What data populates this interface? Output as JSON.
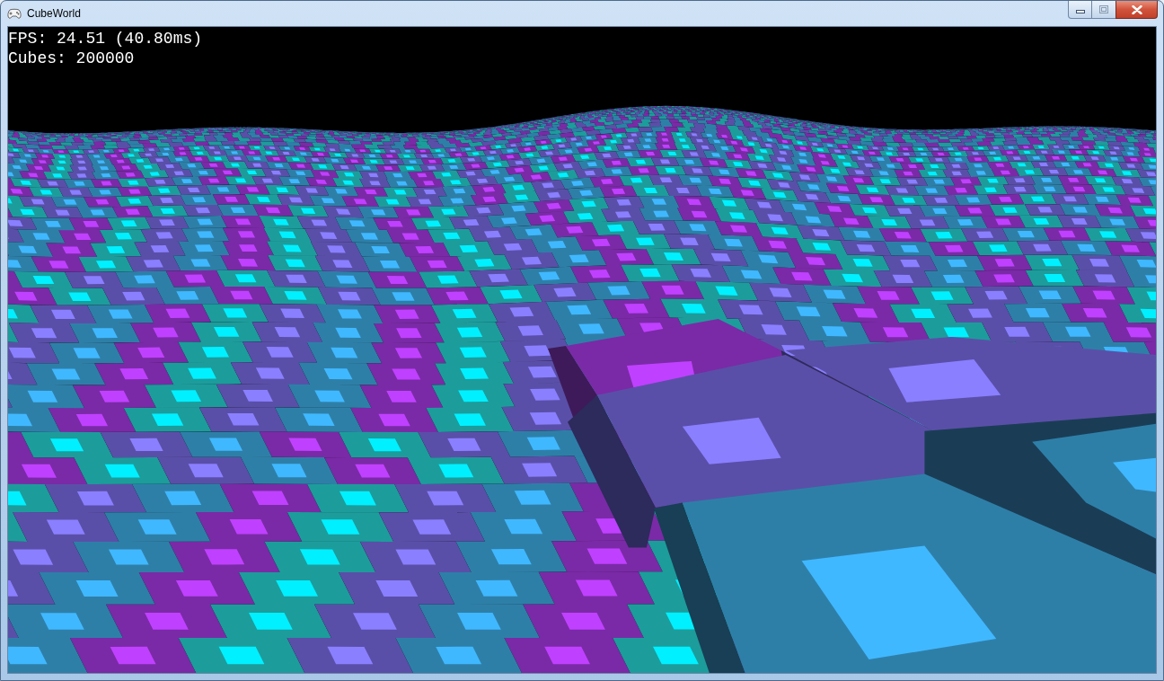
{
  "window": {
    "title": "CubeWorld"
  },
  "hud_lines": [
    "FPS: 24.51 (40.80ms)",
    "Cubes: 200000"
  ]
}
